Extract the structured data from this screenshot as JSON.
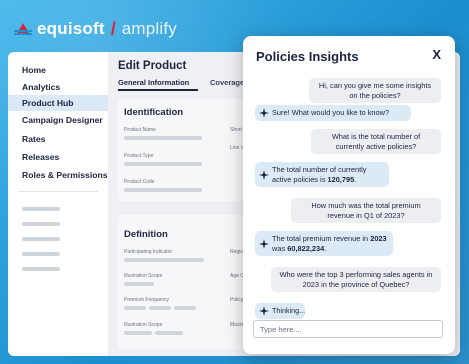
{
  "brand": {
    "name": "equisoft",
    "product": "amplify",
    "accent": "#d7283b"
  },
  "sidebar": {
    "items": [
      {
        "label": "Home"
      },
      {
        "label": "Analytics"
      },
      {
        "label": "Product Hub"
      },
      {
        "label": "Campaign Designer"
      },
      {
        "label": "Rates"
      },
      {
        "label": "Releases"
      },
      {
        "label": "Roles & Permissions"
      }
    ],
    "active_index": 2
  },
  "main": {
    "title": "Edit Product",
    "tabs": [
      {
        "label": "General Information"
      },
      {
        "label": "Coverage"
      }
    ],
    "identification": {
      "title": "Identification",
      "fields": [
        "Product Name",
        "Product Type",
        "Product Code",
        "Short",
        "Line of"
      ]
    },
    "definition": {
      "title": "Definition",
      "fields": [
        "Participating Indicator",
        "Illustration Scope",
        "Premium Frequency",
        "Illustration Scope",
        "Regist",
        "Age C",
        "Policy",
        "Maxim"
      ]
    }
  },
  "insights": {
    "title": "Policies Insights",
    "close_label": "X",
    "messages": [
      {
        "role": "user",
        "text": "Hi, can you give me some insights on the policies?"
      },
      {
        "role": "bot",
        "text": "Sure! What would you like to know?"
      },
      {
        "role": "user",
        "text": "What is the total number of currently active policies?"
      },
      {
        "role": "bot",
        "text": "The total number of currently active policies is",
        "bold": "120,795",
        "suffix": "."
      },
      {
        "role": "user",
        "text": "How much was the total premium revenue in Q1 of 2023?"
      },
      {
        "role": "bot",
        "text": "The total premium revenue in",
        "bold": "2023",
        "mid": "was",
        "bold2": "60,822,234",
        "suffix": "."
      },
      {
        "role": "user",
        "text": "Who were the top 3 performing sales agents in 2023 in the province of Quebec?"
      },
      {
        "role": "bot",
        "text": "Thinking..."
      }
    ],
    "input_placeholder": "Type here...."
  }
}
